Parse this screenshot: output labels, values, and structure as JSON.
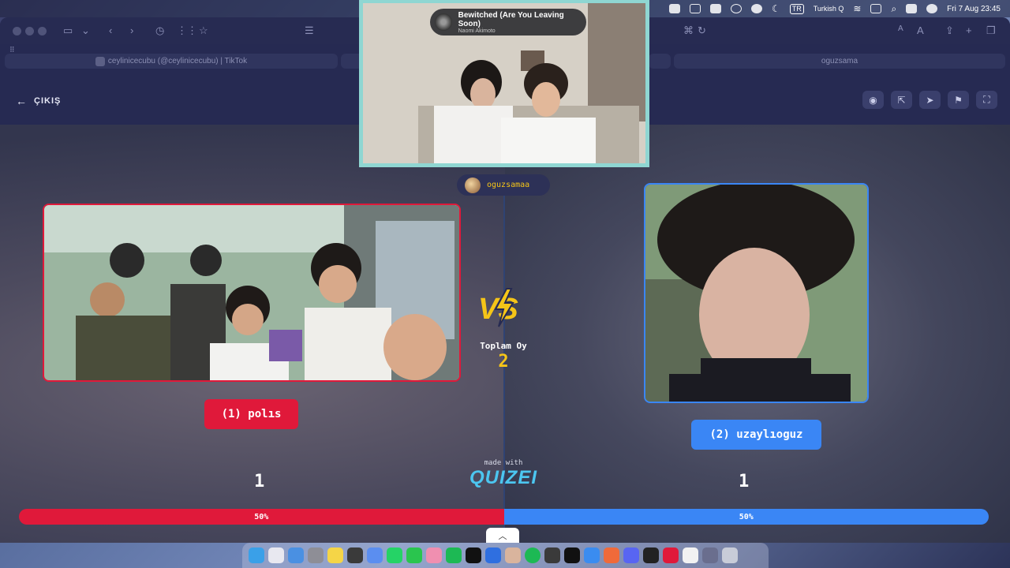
{
  "menubar": {
    "input_source": "TR",
    "input_name": "Turkish Q",
    "clock": "Fri 7 Aug  23:45"
  },
  "browser": {
    "tabs": [
      {
        "label": "ceylinicecubu (@ceylinicecubu) | TikTok"
      },
      {
        "label": "oguzsama"
      }
    ]
  },
  "app": {
    "exit_label": "ÇIKIŞ",
    "creator": "oguzsamaa",
    "left": {
      "label": "(1) polıs",
      "votes": "1",
      "percent": "50%"
    },
    "right": {
      "label": "(2) uzaylıoguz",
      "votes": "1",
      "percent": "50%"
    },
    "vs_text": "VS",
    "total_label": "Toplam Oy",
    "total_value": "2",
    "made_with": "made with",
    "brand": "QUIZEI"
  },
  "pip": {
    "song_title": "Bewitched (Are You Leaving Soon)",
    "song_artist": "Naomi Akimoto"
  },
  "colors": {
    "red": "#e0193a",
    "blue": "#3a86f5",
    "gold": "#f5c518",
    "brand": "#4cc6f0"
  }
}
